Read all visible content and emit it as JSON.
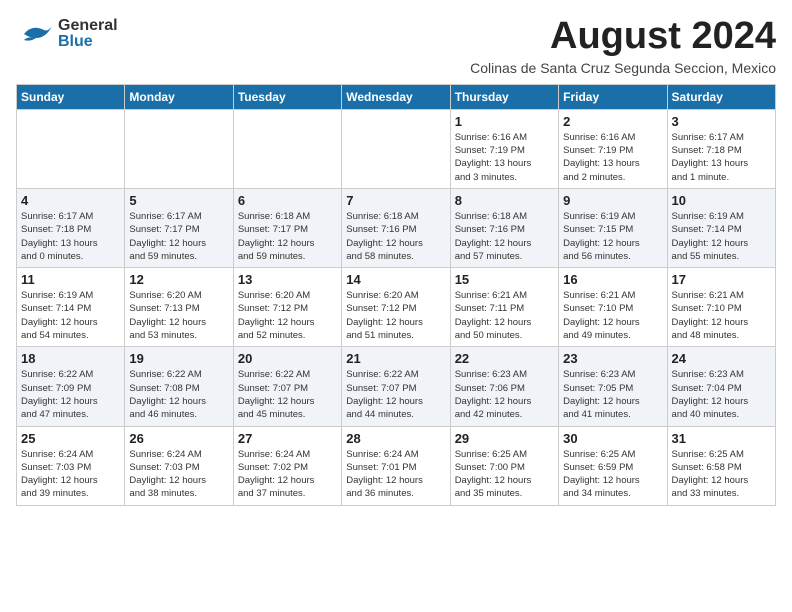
{
  "header": {
    "logo_general": "General",
    "logo_blue": "Blue",
    "month_year": "August 2024",
    "location": "Colinas de Santa Cruz Segunda Seccion, Mexico"
  },
  "weekdays": [
    "Sunday",
    "Monday",
    "Tuesday",
    "Wednesday",
    "Thursday",
    "Friday",
    "Saturday"
  ],
  "weeks": [
    [
      {
        "day": "",
        "info": ""
      },
      {
        "day": "",
        "info": ""
      },
      {
        "day": "",
        "info": ""
      },
      {
        "day": "",
        "info": ""
      },
      {
        "day": "1",
        "info": "Sunrise: 6:16 AM\nSunset: 7:19 PM\nDaylight: 13 hours\nand 3 minutes."
      },
      {
        "day": "2",
        "info": "Sunrise: 6:16 AM\nSunset: 7:19 PM\nDaylight: 13 hours\nand 2 minutes."
      },
      {
        "day": "3",
        "info": "Sunrise: 6:17 AM\nSunset: 7:18 PM\nDaylight: 13 hours\nand 1 minute."
      }
    ],
    [
      {
        "day": "4",
        "info": "Sunrise: 6:17 AM\nSunset: 7:18 PM\nDaylight: 13 hours\nand 0 minutes."
      },
      {
        "day": "5",
        "info": "Sunrise: 6:17 AM\nSunset: 7:17 PM\nDaylight: 12 hours\nand 59 minutes."
      },
      {
        "day": "6",
        "info": "Sunrise: 6:18 AM\nSunset: 7:17 PM\nDaylight: 12 hours\nand 59 minutes."
      },
      {
        "day": "7",
        "info": "Sunrise: 6:18 AM\nSunset: 7:16 PM\nDaylight: 12 hours\nand 58 minutes."
      },
      {
        "day": "8",
        "info": "Sunrise: 6:18 AM\nSunset: 7:16 PM\nDaylight: 12 hours\nand 57 minutes."
      },
      {
        "day": "9",
        "info": "Sunrise: 6:19 AM\nSunset: 7:15 PM\nDaylight: 12 hours\nand 56 minutes."
      },
      {
        "day": "10",
        "info": "Sunrise: 6:19 AM\nSunset: 7:14 PM\nDaylight: 12 hours\nand 55 minutes."
      }
    ],
    [
      {
        "day": "11",
        "info": "Sunrise: 6:19 AM\nSunset: 7:14 PM\nDaylight: 12 hours\nand 54 minutes."
      },
      {
        "day": "12",
        "info": "Sunrise: 6:20 AM\nSunset: 7:13 PM\nDaylight: 12 hours\nand 53 minutes."
      },
      {
        "day": "13",
        "info": "Sunrise: 6:20 AM\nSunset: 7:12 PM\nDaylight: 12 hours\nand 52 minutes."
      },
      {
        "day": "14",
        "info": "Sunrise: 6:20 AM\nSunset: 7:12 PM\nDaylight: 12 hours\nand 51 minutes."
      },
      {
        "day": "15",
        "info": "Sunrise: 6:21 AM\nSunset: 7:11 PM\nDaylight: 12 hours\nand 50 minutes."
      },
      {
        "day": "16",
        "info": "Sunrise: 6:21 AM\nSunset: 7:10 PM\nDaylight: 12 hours\nand 49 minutes."
      },
      {
        "day": "17",
        "info": "Sunrise: 6:21 AM\nSunset: 7:10 PM\nDaylight: 12 hours\nand 48 minutes."
      }
    ],
    [
      {
        "day": "18",
        "info": "Sunrise: 6:22 AM\nSunset: 7:09 PM\nDaylight: 12 hours\nand 47 minutes."
      },
      {
        "day": "19",
        "info": "Sunrise: 6:22 AM\nSunset: 7:08 PM\nDaylight: 12 hours\nand 46 minutes."
      },
      {
        "day": "20",
        "info": "Sunrise: 6:22 AM\nSunset: 7:07 PM\nDaylight: 12 hours\nand 45 minutes."
      },
      {
        "day": "21",
        "info": "Sunrise: 6:22 AM\nSunset: 7:07 PM\nDaylight: 12 hours\nand 44 minutes."
      },
      {
        "day": "22",
        "info": "Sunrise: 6:23 AM\nSunset: 7:06 PM\nDaylight: 12 hours\nand 42 minutes."
      },
      {
        "day": "23",
        "info": "Sunrise: 6:23 AM\nSunset: 7:05 PM\nDaylight: 12 hours\nand 41 minutes."
      },
      {
        "day": "24",
        "info": "Sunrise: 6:23 AM\nSunset: 7:04 PM\nDaylight: 12 hours\nand 40 minutes."
      }
    ],
    [
      {
        "day": "25",
        "info": "Sunrise: 6:24 AM\nSunset: 7:03 PM\nDaylight: 12 hours\nand 39 minutes."
      },
      {
        "day": "26",
        "info": "Sunrise: 6:24 AM\nSunset: 7:03 PM\nDaylight: 12 hours\nand 38 minutes."
      },
      {
        "day": "27",
        "info": "Sunrise: 6:24 AM\nSunset: 7:02 PM\nDaylight: 12 hours\nand 37 minutes."
      },
      {
        "day": "28",
        "info": "Sunrise: 6:24 AM\nSunset: 7:01 PM\nDaylight: 12 hours\nand 36 minutes."
      },
      {
        "day": "29",
        "info": "Sunrise: 6:25 AM\nSunset: 7:00 PM\nDaylight: 12 hours\nand 35 minutes."
      },
      {
        "day": "30",
        "info": "Sunrise: 6:25 AM\nSunset: 6:59 PM\nDaylight: 12 hours\nand 34 minutes."
      },
      {
        "day": "31",
        "info": "Sunrise: 6:25 AM\nSunset: 6:58 PM\nDaylight: 12 hours\nand 33 minutes."
      }
    ]
  ],
  "alt_rows": [
    1,
    3
  ]
}
